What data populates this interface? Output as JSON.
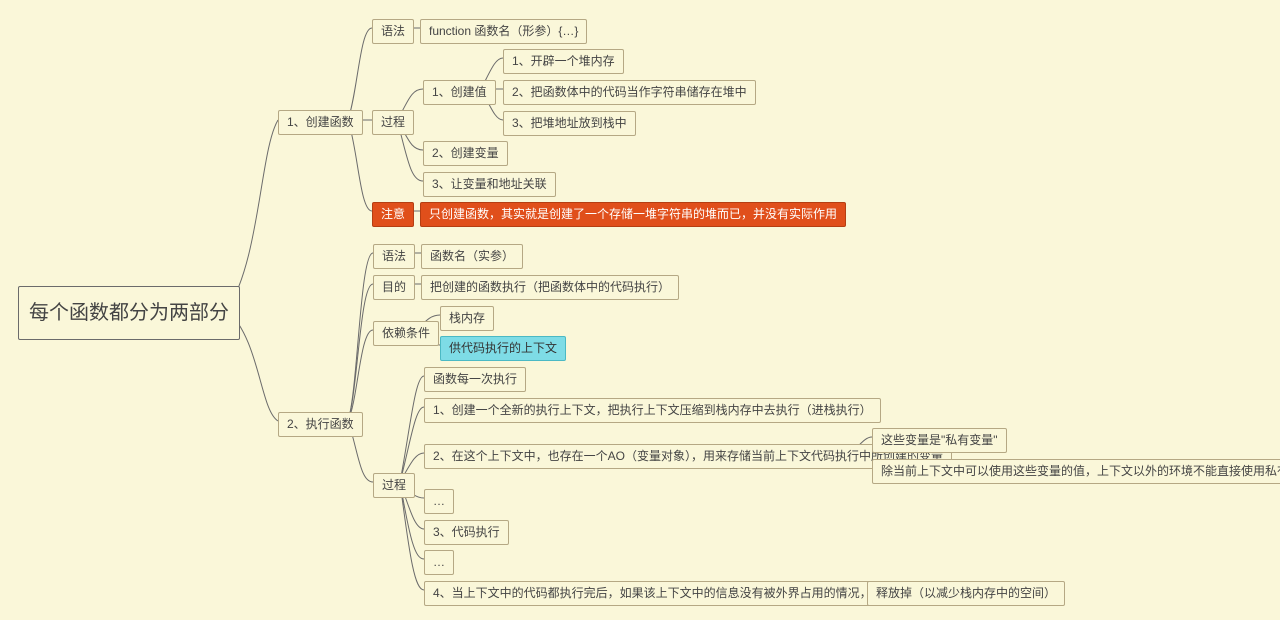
{
  "root": "每个函数都分为两部分",
  "b1": {
    "title": "1、创建函数",
    "syntax": {
      "k": "语法",
      "v": "function 函数名（形参）{…}"
    },
    "proc": {
      "k": "过程",
      "c1": {
        "k": "1、创建值",
        "s1": "1、开辟一个堆内存",
        "s2": "2、把函数体中的代码当作字符串储存在堆中",
        "s3": "3、把堆地址放到栈中"
      },
      "c2": "2、创建变量",
      "c3": "3、让变量和地址关联"
    },
    "note": {
      "k": "注意",
      "v": "只创建函数，其实就是创建了一个存储一堆字符串的堆而已，并没有实际作用"
    }
  },
  "b2": {
    "title": "2、执行函数",
    "syntax": {
      "k": "语法",
      "v": "函数名（实参）"
    },
    "purpose": {
      "k": "目的",
      "v": "把创建的函数执行（把函数体中的代码执行）"
    },
    "dep": {
      "k": "依赖条件",
      "d1": "栈内存",
      "d2": "供代码执行的上下文"
    },
    "proc": {
      "k": "过程",
      "p0": "函数每一次执行",
      "p1": "1、创建一个全新的执行上下文，把执行上下文压缩到栈内存中去执行（进栈执行）",
      "p2": "2、在这个上下文中，也存在一个AO（变量对象），用来存储当前上下文代码执行中所创建的变量",
      "p2a": "这些变量是\"私有变量\"",
      "p2b": "除当前上下文中可以使用这些变量的值，上下文以外的环境不能直接使用私有变量的值",
      "pd1": "…",
      "p3": "3、代码执行",
      "pd2": "…",
      "p4": "4、当上下文中的代码都执行完后，如果该上下文中的信息没有被外界占用的情况，则执行完出栈",
      "p4a": "释放掉（以减少栈内存中的空间）"
    }
  }
}
